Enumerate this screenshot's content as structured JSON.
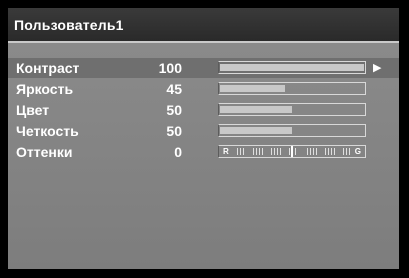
{
  "window": {
    "title": "Пользователь1"
  },
  "colors": {
    "panel_bg": "#858585",
    "title_bg": "#333333",
    "selected_row_bg": "#6f6f6f",
    "text": "#ffffff",
    "slider_fill": "#c8c8c8"
  },
  "settings": [
    {
      "label": "Контраст",
      "value": "100",
      "level": 1.0,
      "selected": true
    },
    {
      "label": "Яркость",
      "value": "45",
      "level": 0.45,
      "selected": false
    },
    {
      "label": "Цвет",
      "value": "50",
      "level": 0.5,
      "selected": false
    },
    {
      "label": "Четкость",
      "value": "50",
      "level": 0.5,
      "selected": false
    },
    {
      "label": "Оттенки",
      "value": "0",
      "level": 0.5,
      "selected": false
    }
  ],
  "tint_scale": {
    "left_label": "R",
    "right_label": "G"
  },
  "icons": {
    "selection_arrow": "right-arrow-icon"
  }
}
